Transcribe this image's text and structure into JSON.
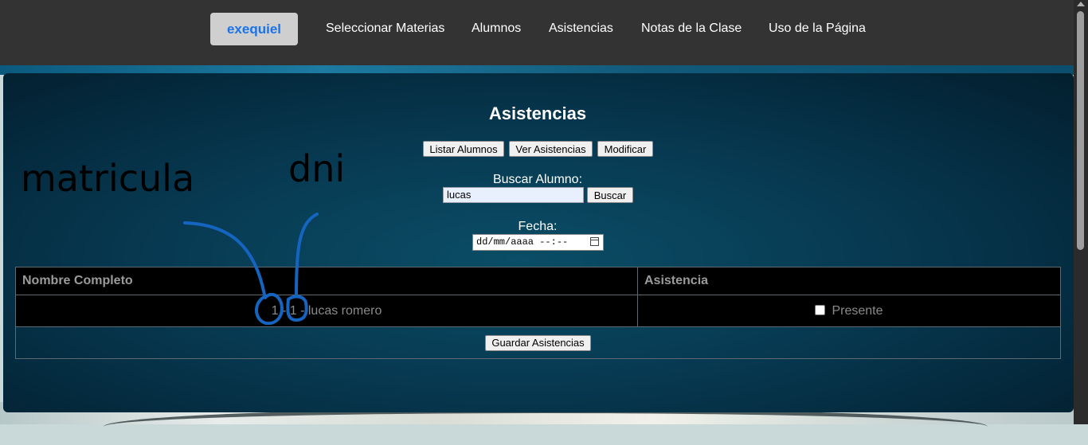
{
  "nav": {
    "user_label": "exequiel",
    "links": [
      "Seleccionar Materias",
      "Alumnos",
      "Asistencias",
      "Notas de la Clase",
      "Uso de la Página"
    ]
  },
  "page": {
    "title": "Asistencias",
    "buttons": {
      "listar": "Listar Alumnos",
      "ver": "Ver Asistencias",
      "modificar": "Modificar"
    },
    "search": {
      "label": "Buscar Alumno:",
      "value": "lucas",
      "button": "Buscar"
    },
    "fecha": {
      "label": "Fecha:",
      "placeholder": "dd/mm/aaaa --:--"
    }
  },
  "table": {
    "headers": [
      "Nombre Completo",
      "Asistencia"
    ],
    "rows": [
      {
        "nombre": "1 - 1 - lucas romero",
        "asistencia_label": "Presente",
        "presente": false
      }
    ],
    "save_button": "Guardar Asistencias"
  },
  "annotations": {
    "matricula": "matricula",
    "dni": "dni",
    "color": "#1565c0"
  },
  "colors": {
    "navbar": "#333333",
    "user_button_text": "#1a73e8",
    "panel": "#073a52"
  }
}
